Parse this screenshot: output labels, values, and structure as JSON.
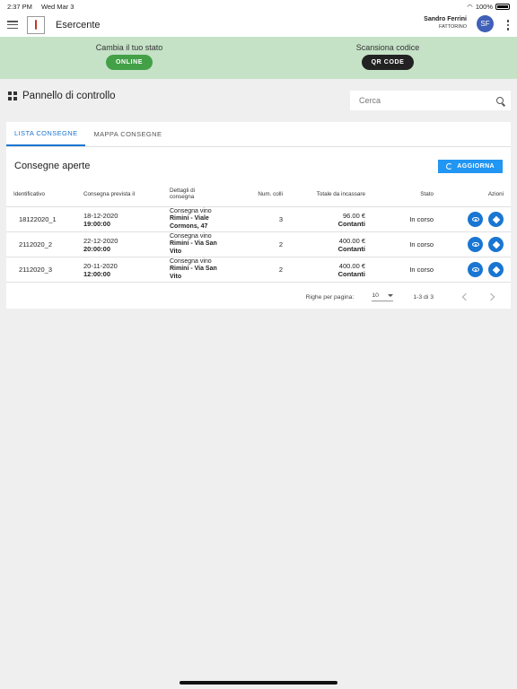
{
  "status": {
    "time": "2:37 PM",
    "date": "Wed Mar 3",
    "battery": "100%"
  },
  "appbar": {
    "title": "Esercente",
    "user_name": "Sandro Ferrini",
    "user_role": "FATTORINO",
    "avatar_initials": "SF"
  },
  "banner": {
    "state_label": "Cambia il tuo stato",
    "state_button": "ONLINE",
    "scan_label": "Scansiona codice",
    "scan_button": "QR CODE"
  },
  "dashboard": {
    "title": "Pannello di controllo",
    "search_placeholder": "Cerca"
  },
  "tabs": [
    "LISTA CONSEGNE",
    "MAPPA CONSEGNE"
  ],
  "card": {
    "title": "Consegne aperte",
    "refresh_label": "AGGIORNA"
  },
  "table": {
    "headers": [
      "Identificativo",
      "Consegna prevista il",
      "Dettagli di consegna",
      "Num. colli",
      "Totale da incassare",
      "Stato",
      "Azioni"
    ],
    "rows": [
      {
        "id": "18122020_1",
        "date": "18-12-2020",
        "time": "19:00:00",
        "detail": "Consegna vino",
        "address": "Rimini - Viale Cormons, 47",
        "colli": "3",
        "amount": "96.00 €",
        "payment": "Contanti",
        "status": "In corso"
      },
      {
        "id": "2112020_2",
        "date": "22-12-2020",
        "time": "20:00:00",
        "detail": "Consegna vino",
        "address": "Rimini - Via San Vito",
        "colli": "2",
        "amount": "400.00 €",
        "payment": "Contanti",
        "status": "In corso"
      },
      {
        "id": "2112020_3",
        "date": "20-11-2020",
        "time": "12:00:00",
        "detail": "Consegna vino",
        "address": "Rimini - Via San Vito",
        "colli": "2",
        "amount": "400.00 €",
        "payment": "Contanti",
        "status": "In corso"
      }
    ]
  },
  "pagination": {
    "rows_per_page_label": "Righe per pagina:",
    "rows_per_page": "10",
    "range": "1-3 di 3"
  },
  "colors": {
    "accent": "#1976d2",
    "online": "#43a047",
    "banner": "#c5e2c7"
  }
}
